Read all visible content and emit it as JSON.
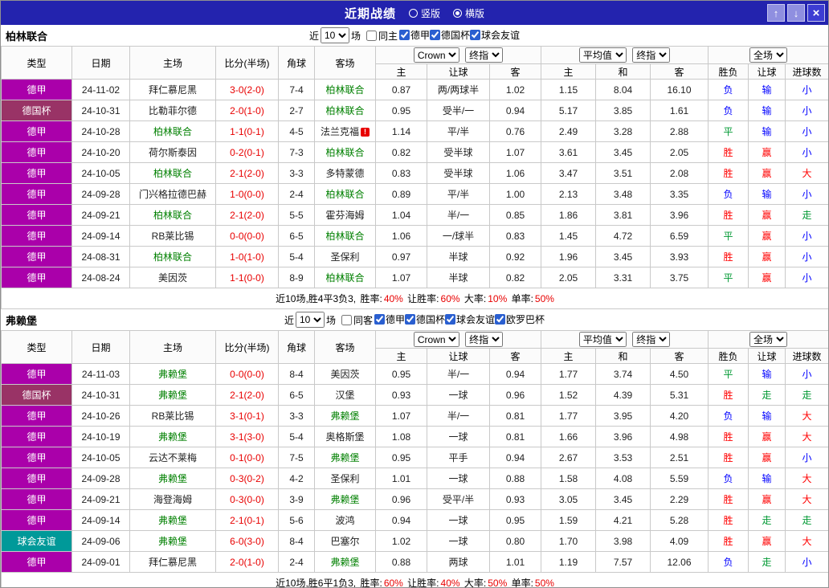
{
  "title_bar": {
    "title": "近期战绩",
    "layout_vertical": "竖版",
    "layout_horizontal": "横版"
  },
  "controls": {
    "near": "近",
    "matches": "场",
    "count": "10",
    "bookmaker": "Crown",
    "final_index": "终指",
    "average": "平均值",
    "full_match": "全场"
  },
  "table_headers": [
    "类型",
    "日期",
    "主场",
    "比分(半场)",
    "角球",
    "客场",
    "主",
    "让球",
    "客",
    "主",
    "和",
    "客",
    "胜负",
    "让球",
    "进球数"
  ],
  "type_colors": {
    "德甲": "#aa00aa",
    "德国杯": "#993366",
    "球会友谊": "#009999"
  },
  "result_colors": {
    "胜": "#ff0000",
    "赢": "#ff0000",
    "大": "#ff0000",
    "平": "#009933",
    "走": "#009933",
    "负": "#0000ff",
    "输": "#0000ff",
    "小": "#0000ff"
  },
  "sections": [
    {
      "team": "柏林联合",
      "filter": {
        "same_label": "同主",
        "same_checked": false,
        "leagues": [
          "德甲",
          "德国杯",
          "球会友谊"
        ]
      },
      "rows": [
        {
          "type": "德甲",
          "date": "24-11-02",
          "home": "拜仁慕尼黑",
          "score": "3-0(2-0)",
          "corner": "7-4",
          "away": "柏林联合",
          "ah_home": "0.87",
          "handicap": "两/两球半",
          "ah_away": "1.02",
          "eu_home": "1.15",
          "eu_draw": "8.04",
          "eu_away": "16.10",
          "result": "负",
          "ah_result": "输",
          "goals": "小"
        },
        {
          "type": "德国杯",
          "date": "24-10-31",
          "home": "比勒菲尔德",
          "score": "2-0(1-0)",
          "corner": "2-7",
          "away": "柏林联合",
          "ah_home": "0.95",
          "handicap": "受半/一",
          "ah_away": "0.94",
          "eu_home": "5.17",
          "eu_draw": "3.85",
          "eu_away": "1.61",
          "result": "负",
          "ah_result": "输",
          "goals": "小"
        },
        {
          "type": "德甲",
          "date": "24-10-28",
          "home": "柏林联合",
          "score": "1-1(0-1)",
          "corner": "4-5",
          "away": "法兰克福",
          "away_icon": true,
          "ah_home": "1.14",
          "handicap": "平/半",
          "ah_away": "0.76",
          "eu_home": "2.49",
          "eu_draw": "3.28",
          "eu_away": "2.88",
          "result": "平",
          "ah_result": "输",
          "goals": "小"
        },
        {
          "type": "德甲",
          "date": "24-10-20",
          "home": "荷尔斯泰因",
          "score": "0-2(0-1)",
          "corner": "7-3",
          "away": "柏林联合",
          "ah_home": "0.82",
          "handicap": "受半球",
          "ah_away": "1.07",
          "eu_home": "3.61",
          "eu_draw": "3.45",
          "eu_away": "2.05",
          "result": "胜",
          "ah_result": "赢",
          "goals": "小"
        },
        {
          "type": "德甲",
          "date": "24-10-05",
          "home": "柏林联合",
          "score": "2-1(2-0)",
          "corner": "3-3",
          "away": "多特蒙德",
          "ah_home": "0.83",
          "handicap": "受半球",
          "ah_away": "1.06",
          "eu_home": "3.47",
          "eu_draw": "3.51",
          "eu_away": "2.08",
          "result": "胜",
          "ah_result": "赢",
          "goals": "大"
        },
        {
          "type": "德甲",
          "date": "24-09-28",
          "home": "门兴格拉德巴赫",
          "score": "1-0(0-0)",
          "corner": "2-4",
          "away": "柏林联合",
          "ah_home": "0.89",
          "handicap": "平/半",
          "ah_away": "1.00",
          "eu_home": "2.13",
          "eu_draw": "3.48",
          "eu_away": "3.35",
          "result": "负",
          "ah_result": "输",
          "goals": "小"
        },
        {
          "type": "德甲",
          "date": "24-09-21",
          "home": "柏林联合",
          "score": "2-1(2-0)",
          "corner": "5-5",
          "away": "霍芬海姆",
          "ah_home": "1.04",
          "handicap": "半/一",
          "ah_away": "0.85",
          "eu_home": "1.86",
          "eu_draw": "3.81",
          "eu_away": "3.96",
          "result": "胜",
          "ah_result": "赢",
          "goals": "走"
        },
        {
          "type": "德甲",
          "date": "24-09-14",
          "home": "RB莱比锡",
          "score": "0-0(0-0)",
          "corner": "6-5",
          "away": "柏林联合",
          "ah_home": "1.06",
          "handicap": "一/球半",
          "ah_away": "0.83",
          "eu_home": "1.45",
          "eu_draw": "4.72",
          "eu_away": "6.59",
          "result": "平",
          "ah_result": "赢",
          "goals": "小"
        },
        {
          "type": "德甲",
          "date": "24-08-31",
          "home": "柏林联合",
          "score": "1-0(1-0)",
          "corner": "5-4",
          "away": "圣保利",
          "ah_home": "0.97",
          "handicap": "半球",
          "ah_away": "0.92",
          "eu_home": "1.96",
          "eu_draw": "3.45",
          "eu_away": "3.93",
          "result": "胜",
          "ah_result": "赢",
          "goals": "小"
        },
        {
          "type": "德甲",
          "date": "24-08-24",
          "home": "美因茨",
          "score": "1-1(0-0)",
          "corner": "8-9",
          "away": "柏林联合",
          "ah_home": "1.07",
          "handicap": "半球",
          "ah_away": "0.82",
          "eu_home": "2.05",
          "eu_draw": "3.31",
          "eu_away": "3.75",
          "result": "平",
          "ah_result": "赢",
          "goals": "小"
        }
      ],
      "summary": {
        "prefix": "近10场,胜4平3负3,",
        "stats": [
          {
            "label": "胜率:",
            "value": "40%"
          },
          {
            "label": "让胜率:",
            "value": "60%"
          },
          {
            "label": "大率:",
            "value": "10%"
          },
          {
            "label": "单率:",
            "value": "50%"
          }
        ]
      }
    },
    {
      "team": "弗赖堡",
      "filter": {
        "same_label": "同客",
        "same_checked": false,
        "leagues": [
          "德甲",
          "德国杯",
          "球会友谊",
          "欧罗巴杯"
        ]
      },
      "rows": [
        {
          "type": "德甲",
          "date": "24-11-03",
          "home": "弗赖堡",
          "score": "0-0(0-0)",
          "corner": "8-4",
          "away": "美因茨",
          "ah_home": "0.95",
          "handicap": "半/一",
          "ah_away": "0.94",
          "eu_home": "1.77",
          "eu_draw": "3.74",
          "eu_away": "4.50",
          "result": "平",
          "ah_result": "输",
          "goals": "小"
        },
        {
          "type": "德国杯",
          "date": "24-10-31",
          "home": "弗赖堡",
          "score": "2-1(2-0)",
          "corner": "6-5",
          "away": "汉堡",
          "ah_home": "0.93",
          "handicap": "一球",
          "ah_away": "0.96",
          "eu_home": "1.52",
          "eu_draw": "4.39",
          "eu_away": "5.31",
          "result": "胜",
          "ah_result": "走",
          "goals": "走"
        },
        {
          "type": "德甲",
          "date": "24-10-26",
          "home": "RB莱比锡",
          "score": "3-1(0-1)",
          "corner": "3-3",
          "away": "弗赖堡",
          "ah_home": "1.07",
          "handicap": "半/一",
          "ah_away": "0.81",
          "eu_home": "1.77",
          "eu_draw": "3.95",
          "eu_away": "4.20",
          "result": "负",
          "ah_result": "输",
          "goals": "大"
        },
        {
          "type": "德甲",
          "date": "24-10-19",
          "home": "弗赖堡",
          "score": "3-1(3-0)",
          "corner": "5-4",
          "away": "奥格斯堡",
          "ah_home": "1.08",
          "handicap": "一球",
          "ah_away": "0.81",
          "eu_home": "1.66",
          "eu_draw": "3.96",
          "eu_away": "4.98",
          "result": "胜",
          "ah_result": "赢",
          "goals": "大"
        },
        {
          "type": "德甲",
          "date": "24-10-05",
          "home": "云达不莱梅",
          "score": "0-1(0-0)",
          "corner": "7-5",
          "away": "弗赖堡",
          "ah_home": "0.95",
          "handicap": "平手",
          "ah_away": "0.94",
          "eu_home": "2.67",
          "eu_draw": "3.53",
          "eu_away": "2.51",
          "result": "胜",
          "ah_result": "赢",
          "goals": "小"
        },
        {
          "type": "德甲",
          "date": "24-09-28",
          "home": "弗赖堡",
          "score": "0-3(0-2)",
          "corner": "4-2",
          "away": "圣保利",
          "ah_home": "1.01",
          "handicap": "一球",
          "ah_away": "0.88",
          "eu_home": "1.58",
          "eu_draw": "4.08",
          "eu_away": "5.59",
          "result": "负",
          "ah_result": "输",
          "goals": "大"
        },
        {
          "type": "德甲",
          "date": "24-09-21",
          "home": "海登海姆",
          "score": "0-3(0-0)",
          "corner": "3-9",
          "away": "弗赖堡",
          "ah_home": "0.96",
          "handicap": "受平/半",
          "ah_away": "0.93",
          "eu_home": "3.05",
          "eu_draw": "3.45",
          "eu_away": "2.29",
          "result": "胜",
          "ah_result": "赢",
          "goals": "大"
        },
        {
          "type": "德甲",
          "date": "24-09-14",
          "home": "弗赖堡",
          "score": "2-1(0-1)",
          "corner": "5-6",
          "away": "波鸿",
          "ah_home": "0.94",
          "handicap": "一球",
          "ah_away": "0.95",
          "eu_home": "1.59",
          "eu_draw": "4.21",
          "eu_away": "5.28",
          "result": "胜",
          "ah_result": "走",
          "goals": "走"
        },
        {
          "type": "球会友谊",
          "date": "24-09-06",
          "home": "弗赖堡",
          "score": "6-0(3-0)",
          "corner": "8-4",
          "away": "巴塞尔",
          "ah_home": "1.02",
          "handicap": "一球",
          "ah_away": "0.80",
          "eu_home": "1.70",
          "eu_draw": "3.98",
          "eu_away": "4.09",
          "result": "胜",
          "ah_result": "赢",
          "goals": "大"
        },
        {
          "type": "德甲",
          "date": "24-09-01",
          "home": "拜仁慕尼黑",
          "score": "2-0(1-0)",
          "corner": "2-4",
          "away": "弗赖堡",
          "ah_home": "0.88",
          "handicap": "两球",
          "ah_away": "1.01",
          "eu_home": "1.19",
          "eu_draw": "7.57",
          "eu_away": "12.06",
          "result": "负",
          "ah_result": "走",
          "goals": "小"
        }
      ],
      "summary": {
        "prefix": "近10场,胜6平1负3,",
        "stats": [
          {
            "label": "胜率:",
            "value": "60%"
          },
          {
            "label": "让胜率:",
            "value": "40%"
          },
          {
            "label": "大率:",
            "value": "50%"
          },
          {
            "label": "单率:",
            "value": "50%"
          }
        ]
      }
    }
  ]
}
